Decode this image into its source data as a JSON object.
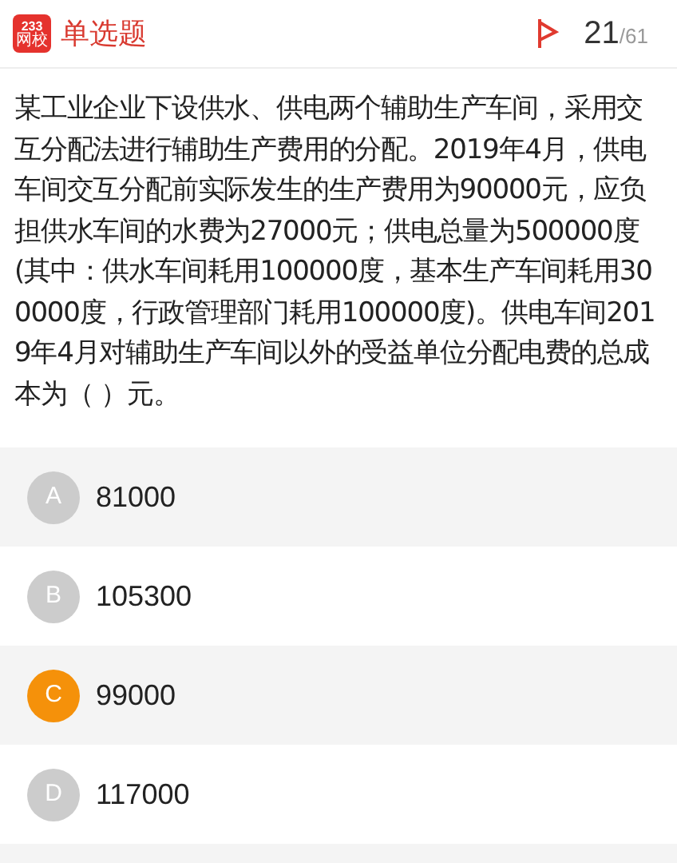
{
  "header": {
    "logo": {
      "line1": "233",
      "line2": "网校"
    },
    "title": "单选题",
    "current": "21",
    "total": "/61"
  },
  "question": "某工业企业下设供水、供电两个辅助生产车间，采用交互分配法进行辅助生产费用的分配。2019年4月，供电车间交互分配前实际发生的生产费用为90000元，应负担供水车间的水费为27000元；供电总量为500000度(其中：供水车间耗用100000度，基本生产车间耗用300000度，行政管理部门耗用100000度)。供电车间2019年4月对辅助生产车间以外的受益单位分配电费的总成本为（ ）元。",
  "options": [
    {
      "letter": "A",
      "text": "81000",
      "selected": false
    },
    {
      "letter": "B",
      "text": "105300",
      "selected": false
    },
    {
      "letter": "C",
      "text": "99000",
      "selected": true
    },
    {
      "letter": "D",
      "text": "117000",
      "selected": false
    }
  ]
}
